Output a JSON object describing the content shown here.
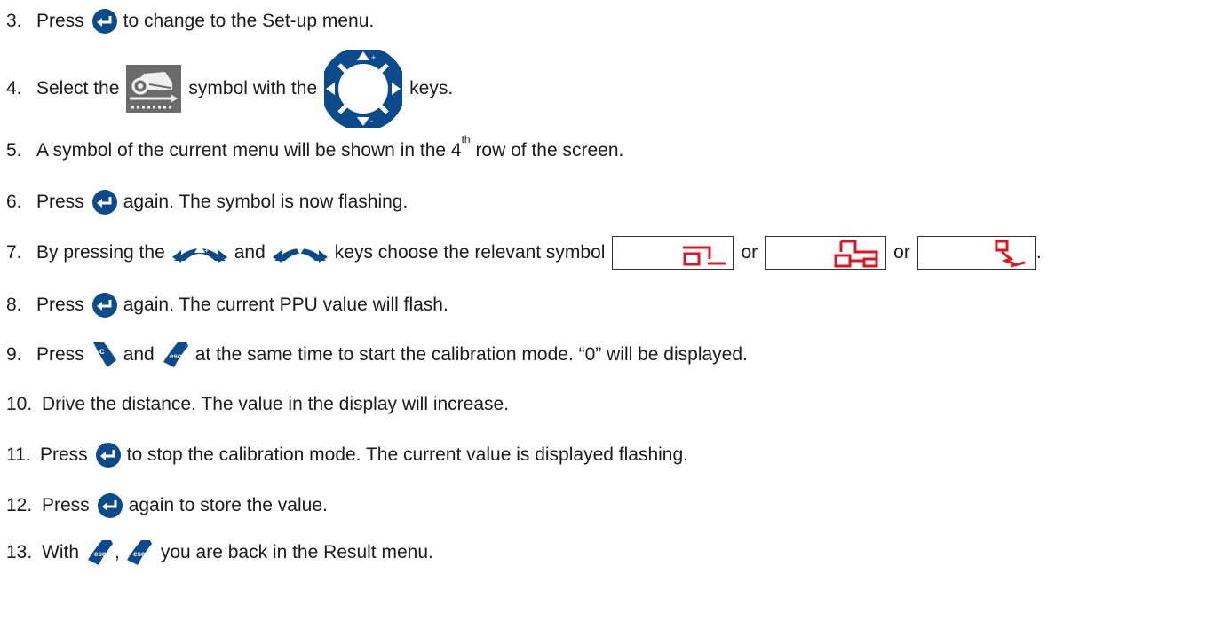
{
  "steps": [
    {
      "num": "3.",
      "a": "Press",
      "b": "to change to the Set-up menu."
    },
    {
      "num": "4.",
      "a": "Select the",
      "b": "symbol with the",
      "c": "keys."
    },
    {
      "num": "5.",
      "a": "A symbol of the current menu will be shown in the 4",
      "sup": "th",
      "b": " row of the screen."
    },
    {
      "num": "6.",
      "a": "Press",
      "b": "again. The symbol is now flashing."
    },
    {
      "num": "7.",
      "a": "By pressing the",
      "b": "and",
      "c": "keys choose the relevant symbol",
      "or1": "or",
      "or2": "or",
      "end": "."
    },
    {
      "num": "8.",
      "a": "Press",
      "b": "again. The current PPU value will flash."
    },
    {
      "num": "9.",
      "a": "Press",
      "b": "and",
      "c": "at the same time to start the calibration mode. “0” will be displayed."
    },
    {
      "num": "10.",
      "a": "Drive the distance. The value in the display will increase."
    },
    {
      "num": "11.",
      "a": "Press",
      "b": "to stop the calibration mode. The current value is displayed flashing."
    },
    {
      "num": "12.",
      "a": "Press",
      "b": "again to store the value."
    },
    {
      "num": "13.",
      "a": "With",
      "comma": ",",
      "b": "you are back in the Result menu."
    }
  ],
  "icons": {
    "enter": "enter-key-icon",
    "arrow_pad": "arrow-keypad-icon",
    "setup": "implement-setup-icon",
    "up": "up-plus-key-icon",
    "down": "down-minus-key-icon",
    "c": "c-key-icon",
    "esc": "esc-key-icon"
  },
  "colors": {
    "key_blue": "#0b4b8c",
    "lcd_red": "#e0141e",
    "text": "#1a1a1a"
  }
}
